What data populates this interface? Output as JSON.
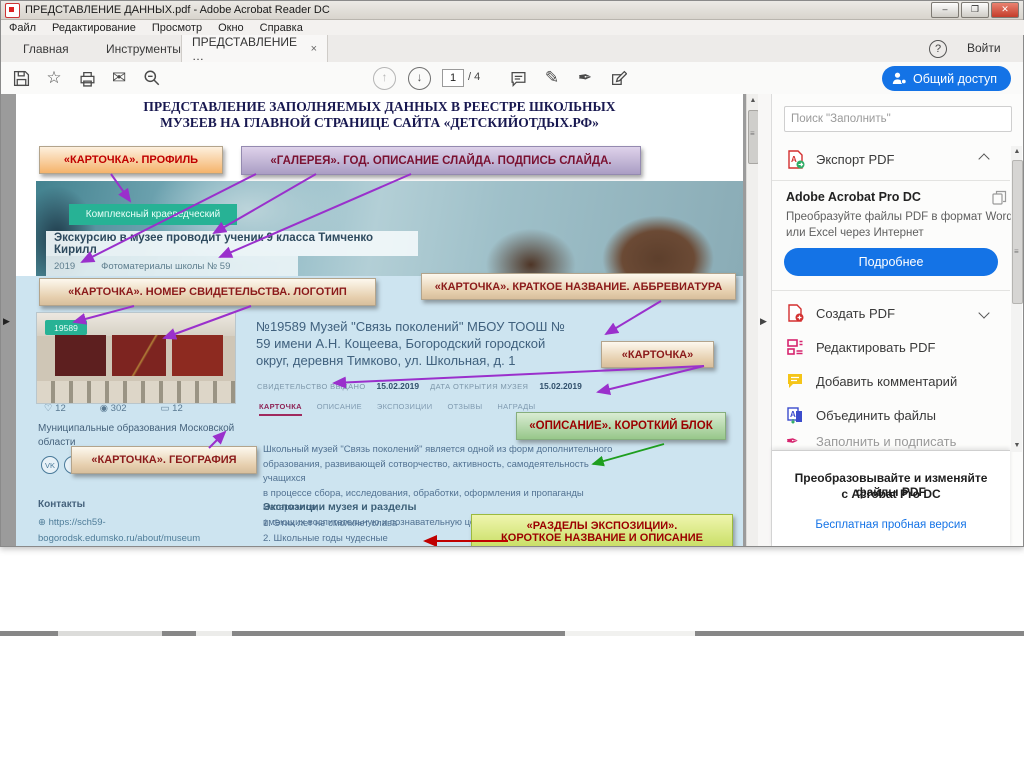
{
  "window": {
    "title": "ПРЕДСТАВЛЕНИЕ ДАННЫХ.pdf - Adobe Acrobat Reader DC",
    "buttons": {
      "minimize": "–",
      "maximize": "❐",
      "close": "✕"
    },
    "menu": [
      "Файл",
      "Редактирование",
      "Просмотр",
      "Окно",
      "Справка"
    ],
    "tabs": {
      "home": "Главная",
      "tools": "Инструменты",
      "doc": "ПРЕДСТАВЛЕНИЕ …",
      "doc_close": "×"
    },
    "help": "?",
    "signin": "Войти",
    "toolbar": {
      "page_current": "1",
      "page_total": "/ 4",
      "share_label": "Общий доступ"
    }
  },
  "sidebar": {
    "search_placeholder": "Поиск \"Заполнить\"",
    "export_label": "Экспорт PDF",
    "pro_title": "Adobe Acrobat Pro DC",
    "pro_desc_1": "Преобразуйте файлы PDF в формат Word",
    "pro_desc_2": "или Excel через Интернет",
    "more_label": "Подробнее",
    "tools": [
      "Создать PDF",
      "Редактировать PDF",
      "Добавить комментарий",
      "Объединить файлы",
      "Заполнить и подписать"
    ],
    "promo_1": "Преобразовывайте и изменяйте файлы PDF",
    "promo_2": "с Acrobat Pro DC",
    "trial_link": "Бесплатная пробная версия"
  },
  "slide": {
    "title_1": "ПРЕДСТАВЛЕНИЕ ЗАПОЛНЯЕМЫХ ДАННЫХ В РЕЕСТРЕ ШКОЛЬНЫХ",
    "title_2": "МУЗЕЕВ НА ГЛАВНОЙ СТРАНИЦЕ САЙТА «ДЕТСКИЙОТДЫХ.РФ»",
    "labels": {
      "profile": "«КАРТОЧКА». ПРОФИЛЬ",
      "gallery": "«ГАЛЕРЕЯ». ГОД. ОПИСАНИЕ СЛАЙДА. ПОДПИСЬ СЛАЙДА.",
      "number": "«КАРТОЧКА». НОМЕР СВИДЕТЕЛЬСТВА. ЛОГОТИП",
      "shortname": "«КАРТОЧКА». КРАТКОЕ НАЗВАНИЕ. АББРЕВИАТУРА",
      "card": "«КАРТОЧКА»",
      "shortblock": "«ОПИСАНИЕ». КОРОТКИЙ БЛОК",
      "geography": "«КАРТОЧКА». ГЕОГРАФИЯ",
      "sections_1": "«РАЗДЕЛЫ ЭКСПОЗИЦИИ».",
      "sections_2": "КОРОТКОЕ НАЗВАНИЕ И ОПИСАНИЕ"
    },
    "photo": {
      "type_badge": "Комплексный краеведческий",
      "caption": "Экскурсию в музее проводит ученик 9 класса Тимченко Кирилл",
      "year": "2019",
      "credit": "Фотоматериалы школы № 59"
    },
    "card": {
      "thumb_badge": "19589",
      "name_1": "№19589 Музей \"Связь поколений\" МБОУ ТООШ №",
      "name_2": "59 имени А.Н. Кощеева, Богородский городской",
      "name_3": "округ, деревня Тимково, ул. Школьная, д. 1",
      "cert_label": "СВИДЕТЕЛЬСТВО ВЫДАНО",
      "cert_date": "15.02.2019",
      "open_label": "ДАТА ОТКРЫТИЯ МУЗЕЯ",
      "open_date": "15.02.2019",
      "tabs": [
        "КАРТОЧКА",
        "ОПИСАНИЕ",
        "ЭКСПОЗИЦИИ",
        "ОТЗЫВЫ",
        "НАГРАДЫ"
      ],
      "likes": "12",
      "views": "302",
      "comments": "12"
    },
    "geo_1": "Муниципальные образования Московской",
    "geo_2": "области",
    "social": "VK",
    "contacts_label": "Контакты",
    "link_1": "https://sch59-",
    "link_2": "bogorodsk.edumsko.ru/about/museum",
    "desc_1": "Школьный музей \"Связь поколений\" является одной из форм дополнительного",
    "desc_2": "образования, развивающей сотворчество, активность, самодеятельность учащихся",
    "desc_3": "в процессе сбора, исследования, обработки, оформления и пропаганды материалов,",
    "desc_4": "имеющих воспитательную и познавательную ценность.",
    "expo_title": "Экспозиции музея и разделы",
    "expo_1": "1. Этих лет не смолкнет слава",
    "expo_2": "2. Школьные годы чудесные"
  }
}
